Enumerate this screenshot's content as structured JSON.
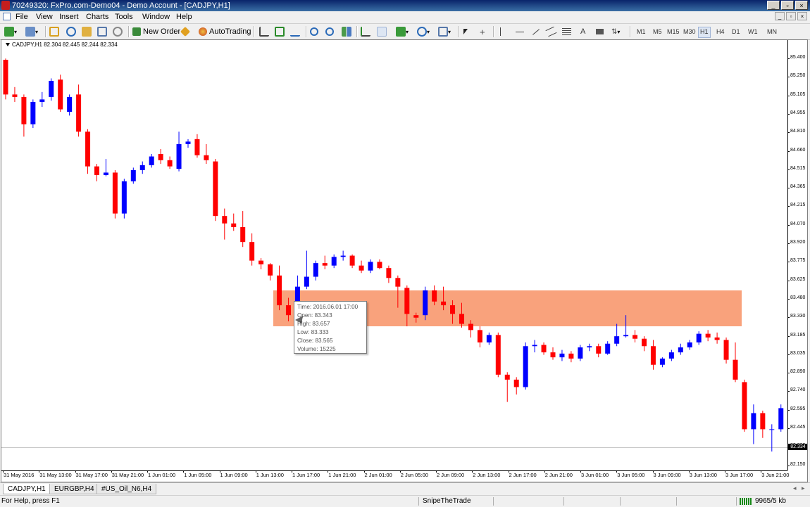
{
  "window": {
    "title": "70249320: FxPro.com-Demo04 - Demo Account - [CADJPY,H1]",
    "buttons": [
      "_",
      "▫",
      "×"
    ]
  },
  "menu": {
    "items": [
      "File",
      "View",
      "Insert",
      "Charts",
      "Tools",
      "Window",
      "Help"
    ],
    "mdi_buttons": [
      "_",
      "▫",
      "×"
    ]
  },
  "toolbar": {
    "new_order_label": "New Order",
    "autotrading_label": "AutoTrading",
    "timeframes": [
      "M1",
      "M5",
      "M15",
      "M30",
      "H1",
      "H4",
      "D1",
      "W1",
      "MN"
    ],
    "active_timeframe": "H1"
  },
  "chart": {
    "info_text": "CADJPY,H1  82.304 82.445 82.244 82.334",
    "bull_color": "#0000ff",
    "bear_color": "#ff0000",
    "zone_color": "#f9a27c",
    "current_price_tag": "82.334",
    "price_labels": [
      "85.400",
      "85.250",
      "85.105",
      "84.955",
      "84.810",
      "84.660",
      "84.515",
      "84.365",
      "84.215",
      "84.070",
      "83.920",
      "83.775",
      "83.625",
      "83.480",
      "83.330",
      "83.185",
      "83.035",
      "82.890",
      "82.740",
      "82.595",
      "82.445",
      "82.300",
      "82.150"
    ],
    "time_labels": [
      "31 May 2016",
      "31 May 13:00",
      "31 May 17:00",
      "31 May 21:00",
      "1 Jun 01:00",
      "1 Jun 05:00",
      "1 Jun 09:00",
      "1 Jun 13:00",
      "1 Jun 17:00",
      "1 Jun 21:00",
      "2 Jun 01:00",
      "2 Jun 05:00",
      "2 Jun 09:00",
      "2 Jun 13:00",
      "2 Jun 17:00",
      "2 Jun 21:00",
      "3 Jun 01:00",
      "3 Jun 05:00",
      "3 Jun 09:00",
      "3 Jun 13:00",
      "3 Jun 17:00",
      "3 Jun 21:00"
    ],
    "tooltip": {
      "time": "Time: 2016.06.01 17:00",
      "open": "Open: 83.343",
      "high": "High: 83.657",
      "low": "Low:  83.333",
      "close": "Close: 83.565",
      "volume": "Volume: 15225"
    }
  },
  "chart_data": {
    "type": "candlestick",
    "symbol": "CADJPY",
    "timeframe": "H1",
    "ylim": [
      82.15,
      85.45
    ],
    "candles": [
      [
        85.4,
        85.41,
        85.08,
        85.12
      ],
      [
        85.12,
        85.18,
        85.06,
        85.1
      ],
      [
        85.1,
        85.12,
        84.78,
        84.88
      ],
      [
        84.88,
        85.08,
        84.85,
        85.06
      ],
      [
        85.06,
        85.14,
        85.02,
        85.08
      ],
      [
        85.1,
        85.25,
        85.07,
        85.23
      ],
      [
        85.24,
        85.28,
        84.98,
        85.0
      ],
      [
        84.98,
        85.12,
        84.95,
        85.1
      ],
      [
        85.12,
        85.2,
        84.78,
        84.82
      ],
      [
        84.82,
        84.84,
        84.48,
        84.54
      ],
      [
        84.54,
        84.56,
        84.42,
        84.47
      ],
      [
        84.47,
        84.6,
        84.46,
        84.49
      ],
      [
        84.49,
        84.51,
        84.12,
        84.16
      ],
      [
        84.16,
        84.44,
        84.12,
        84.42
      ],
      [
        84.42,
        84.53,
        84.4,
        84.51
      ],
      [
        84.51,
        84.58,
        84.48,
        84.55
      ],
      [
        84.55,
        84.64,
        84.53,
        84.62
      ],
      [
        84.64,
        84.68,
        84.56,
        84.59
      ],
      [
        84.59,
        84.62,
        84.52,
        84.54
      ],
      [
        84.52,
        84.82,
        84.5,
        84.72
      ],
      [
        84.72,
        84.76,
        84.69,
        84.74
      ],
      [
        84.76,
        84.8,
        84.61,
        84.63
      ],
      [
        84.63,
        84.72,
        84.56,
        84.59
      ],
      [
        84.58,
        84.6,
        84.1,
        84.14
      ],
      [
        84.14,
        84.2,
        83.95,
        84.08
      ],
      [
        84.08,
        84.16,
        84.02,
        84.05
      ],
      [
        84.05,
        84.18,
        83.89,
        83.93
      ],
      [
        83.93,
        84.0,
        83.74,
        83.78
      ],
      [
        83.78,
        83.8,
        83.71,
        83.75
      ],
      [
        83.75,
        83.76,
        83.62,
        83.66
      ],
      [
        83.66,
        83.74,
        83.38,
        83.42
      ],
      [
        83.42,
        83.48,
        83.29,
        83.34
      ],
      [
        83.34,
        83.66,
        83.33,
        83.57
      ],
      [
        83.57,
        83.86,
        83.55,
        83.65
      ],
      [
        83.65,
        83.78,
        83.62,
        83.76
      ],
      [
        83.76,
        83.82,
        83.71,
        83.74
      ],
      [
        83.74,
        83.83,
        83.72,
        83.81
      ],
      [
        83.81,
        83.86,
        83.78,
        83.82
      ],
      [
        83.82,
        83.83,
        83.72,
        83.74
      ],
      [
        83.74,
        83.78,
        83.68,
        83.7
      ],
      [
        83.7,
        83.79,
        83.68,
        83.77
      ],
      [
        83.77,
        83.79,
        83.71,
        83.72
      ],
      [
        83.72,
        83.74,
        83.6,
        83.64
      ],
      [
        83.64,
        83.66,
        83.4,
        83.57
      ],
      [
        83.56,
        83.58,
        83.25,
        83.35
      ],
      [
        83.34,
        83.36,
        83.28,
        83.32
      ],
      [
        83.34,
        83.57,
        83.3,
        83.54
      ],
      [
        83.54,
        83.58,
        83.42,
        83.45
      ],
      [
        83.45,
        83.57,
        83.38,
        83.42
      ],
      [
        83.42,
        83.46,
        83.27,
        83.35
      ],
      [
        83.35,
        83.44,
        83.24,
        83.27
      ],
      [
        83.27,
        83.3,
        83.16,
        83.22
      ],
      [
        83.22,
        83.25,
        83.08,
        83.12
      ],
      [
        83.12,
        83.2,
        83.1,
        83.18
      ],
      [
        83.18,
        83.2,
        82.84,
        82.86
      ],
      [
        82.86,
        82.88,
        82.64,
        82.82
      ],
      [
        82.82,
        82.84,
        82.7,
        82.76
      ],
      [
        82.76,
        83.12,
        82.74,
        83.09
      ],
      [
        83.09,
        83.14,
        83.04,
        83.1
      ],
      [
        83.1,
        83.12,
        83.02,
        83.04
      ],
      [
        83.04,
        83.08,
        82.98,
        83.0
      ],
      [
        83.0,
        83.06,
        82.97,
        83.03
      ],
      [
        83.03,
        83.05,
        82.96,
        82.99
      ],
      [
        82.99,
        83.1,
        82.97,
        83.08
      ],
      [
        83.08,
        83.11,
        83.05,
        83.09
      ],
      [
        83.09,
        83.11,
        83.0,
        83.03
      ],
      [
        83.03,
        83.13,
        83.02,
        83.11
      ],
      [
        83.11,
        83.27,
        83.09,
        83.17
      ],
      [
        83.17,
        83.34,
        83.16,
        83.18
      ],
      [
        83.18,
        83.22,
        83.12,
        83.15
      ],
      [
        83.15,
        83.17,
        83.05,
        83.09
      ],
      [
        83.09,
        83.14,
        82.9,
        82.94
      ],
      [
        82.94,
        83.0,
        82.92,
        82.99
      ],
      [
        82.99,
        83.06,
        82.97,
        83.04
      ],
      [
        83.04,
        83.11,
        83.02,
        83.08
      ],
      [
        83.08,
        83.14,
        83.06,
        83.12
      ],
      [
        83.12,
        83.21,
        83.1,
        83.19
      ],
      [
        83.19,
        83.22,
        83.13,
        83.16
      ],
      [
        83.16,
        83.2,
        83.11,
        83.14
      ],
      [
        83.14,
        83.16,
        82.95,
        82.98
      ],
      [
        82.98,
        83.12,
        82.8,
        82.82
      ],
      [
        82.8,
        82.82,
        82.4,
        82.42
      ],
      [
        82.42,
        82.62,
        82.3,
        82.55
      ],
      [
        82.55,
        82.57,
        82.35,
        82.42
      ],
      [
        82.42,
        82.46,
        82.24,
        82.42
      ],
      [
        82.42,
        82.62,
        82.4,
        82.59
      ],
      [
        82.59,
        82.6,
        82.35,
        82.43
      ],
      [
        82.43,
        82.46,
        82.24,
        82.34
      ],
      [
        82.3,
        82.45,
        82.24,
        82.33
      ]
    ],
    "zone": {
      "from_index": 30,
      "price_top": 83.6,
      "price_bottom": 83.31
    },
    "price_axis_labels": [
      "85.400",
      "85.250",
      "85.105",
      "84.955",
      "84.810",
      "84.660",
      "84.515",
      "84.365",
      "84.215",
      "84.070",
      "83.920",
      "83.775",
      "83.625",
      "83.480",
      "83.330",
      "83.185",
      "83.035",
      "82.890",
      "82.740",
      "82.595",
      "82.445",
      "82.300",
      "82.150"
    ],
    "time_axis_labels": [
      "31 May 2016",
      "31 May 13:00",
      "31 May 17:00",
      "31 May 21:00",
      "1 Jun 01:00",
      "1 Jun 05:00",
      "1 Jun 09:00",
      "1 Jun 13:00",
      "1 Jun 17:00",
      "1 Jun 21:00",
      "2 Jun 01:00",
      "2 Jun 05:00",
      "2 Jun 09:00",
      "2 Jun 13:00",
      "2 Jun 17:00",
      "2 Jun 21:00",
      "3 Jun 01:00",
      "3 Jun 05:00",
      "3 Jun 09:00",
      "3 Jun 13:00",
      "3 Jun 17:00",
      "3 Jun 21:00"
    ]
  },
  "tabs": [
    "CADJPY,H1",
    "EURGBP,H4",
    "#US_Oil_N6,H4"
  ],
  "status": {
    "help_text": "For Help, press F1",
    "profile": "SnipeTheTrade",
    "traffic": "9965/5 kb"
  }
}
